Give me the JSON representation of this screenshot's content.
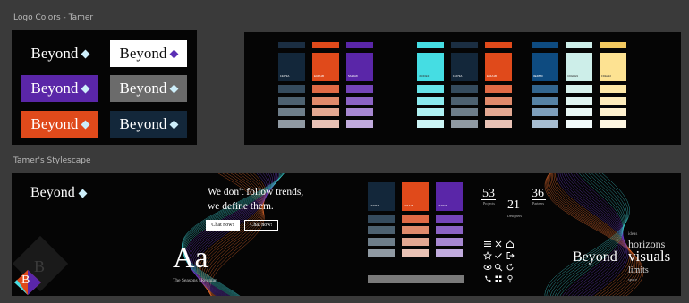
{
  "frames": {
    "logo_colors_title": "Logo Colors - Tamer",
    "stylescape_title": "Tamer's Stylescape"
  },
  "logo_cards": [
    {
      "text": "Beyond",
      "bg": "#050505",
      "fg": "#ffffff",
      "diamond": "#cdeefa"
    },
    {
      "text": "Beyond",
      "bg": "#ffffff",
      "fg": "#111111",
      "diamond": "#5b2fb5"
    },
    {
      "text": "Beyond",
      "bg": "#5a26a8",
      "fg": "#ffffff",
      "diamond": "#cdeefa"
    },
    {
      "text": "Beyond",
      "bg": "#6b6b6b",
      "fg": "#ffffff",
      "diamond": "#cdeefa"
    },
    {
      "text": "Beyond",
      "bg": "#e04a1b",
      "fg": "#ffffff",
      "diamond": "#cdeefa"
    },
    {
      "text": "Beyond",
      "bg": "#13273a",
      "fg": "#ffffff",
      "diamond": "#cdeefa"
    }
  ],
  "palettes": [
    {
      "columns": [
        {
          "top": "#1b2e42",
          "main": "#13273a",
          "label": "13273A",
          "tints": [
            "#354b5d",
            "#4d6170",
            "#6e7e8a",
            "#909aa3"
          ]
        },
        {
          "top": "#e04a1b",
          "main": "#e04a1b",
          "label": "E04A1B",
          "tints": [
            "#e06a45",
            "#e08a6b",
            "#e3a892",
            "#e9c2b5"
          ]
        },
        {
          "top": "#5a26a8",
          "main": "#5a26a8",
          "label": "5A26A8",
          "tints": [
            "#7445b8",
            "#8b63c4",
            "#a788d2",
            "#c1abde"
          ]
        }
      ]
    },
    {
      "columns": [
        {
          "top": "#45dde3",
          "main": "#45dde3",
          "label": "45DDE3",
          "tints": [
            "#66e3e8",
            "#8ae9ed",
            "#aef0f2",
            "#cdf5f6"
          ]
        },
        {
          "top": "#1b2e42",
          "main": "#13273a",
          "label": "13273A",
          "tints": [
            "#354b5d",
            "#4d6170",
            "#6e7e8a",
            "#909aa3"
          ]
        },
        {
          "top": "#e04a1b",
          "main": "#e04a1b",
          "label": "E04A1B",
          "tints": [
            "#e06a45",
            "#e08a6b",
            "#e3a892",
            "#e9c2b5"
          ]
        }
      ]
    },
    {
      "columns": [
        {
          "top": "#0e4b80",
          "main": "#0e4b80",
          "label": "0E4B80",
          "tints": [
            "#33668f",
            "#5682a5",
            "#7e9fbb",
            "#a7bed2"
          ]
        },
        {
          "top": "#cdeee9",
          "main": "#cdeee9",
          "label": "CDEEE9",
          "tints": [
            "#d7f1ed",
            "#e0f4f1",
            "#e9f7f5",
            "#f1fafa"
          ]
        },
        {
          "top": "#f3c960",
          "main": "#fde292",
          "label": "FDE292",
          "tints": [
            "#fde7a6",
            "#fdecbb",
            "#fef1cf",
            "#fef6e2"
          ]
        }
      ]
    }
  ],
  "stylescape": {
    "brand": "Beyond",
    "headline_line1": "We don't follow trends,",
    "headline_line2": "we define them.",
    "btn_primary": "Chat now!",
    "btn_secondary": "Chat now!",
    "type_sample": "Aa",
    "type_caption": "The Seasons | Regular",
    "stats": [
      {
        "num": "53",
        "label": "Projects"
      },
      {
        "num": "21",
        "label": "Designers"
      },
      {
        "num": "36",
        "label": "Partners"
      }
    ],
    "icons": [
      "menu-icon",
      "close-icon",
      "home-icon",
      "star-icon",
      "check-icon",
      "logout-icon",
      "eye-icon",
      "search-icon",
      "refresh-icon",
      "phone-icon",
      "grid-icon",
      "pin-icon"
    ],
    "palette": {
      "columns": [
        {
          "main": "#13273a",
          "label": "13273A",
          "tints": [
            "#354b5d",
            "#4d6170",
            "#6e7e8a",
            "#909aa3"
          ]
        },
        {
          "main": "#e04a1b",
          "label": "E04A1B",
          "tints": [
            "#e06a45",
            "#e08a6b",
            "#e3a892",
            "#e9c2b5"
          ]
        },
        {
          "main": "#5a26a8",
          "label": "5A26A8",
          "tints": [
            "#7445b8",
            "#8b63c4",
            "#a788d2",
            "#c1abde"
          ]
        }
      ]
    },
    "word_cloud": {
      "brand": "Beyond",
      "ideas": "ideas",
      "horizons": "horizons",
      "visuals": "visuals",
      "limits": "limits",
      "space": "space"
    },
    "app_badge_letter": "B",
    "ghost_letter": "B"
  },
  "colors": {
    "panel": "#050505",
    "canvas": "#3a3a3a",
    "wave_teal": "#3ac4c6",
    "wave_orange": "#e0682b",
    "wave_purple": "#6a3ac0"
  }
}
